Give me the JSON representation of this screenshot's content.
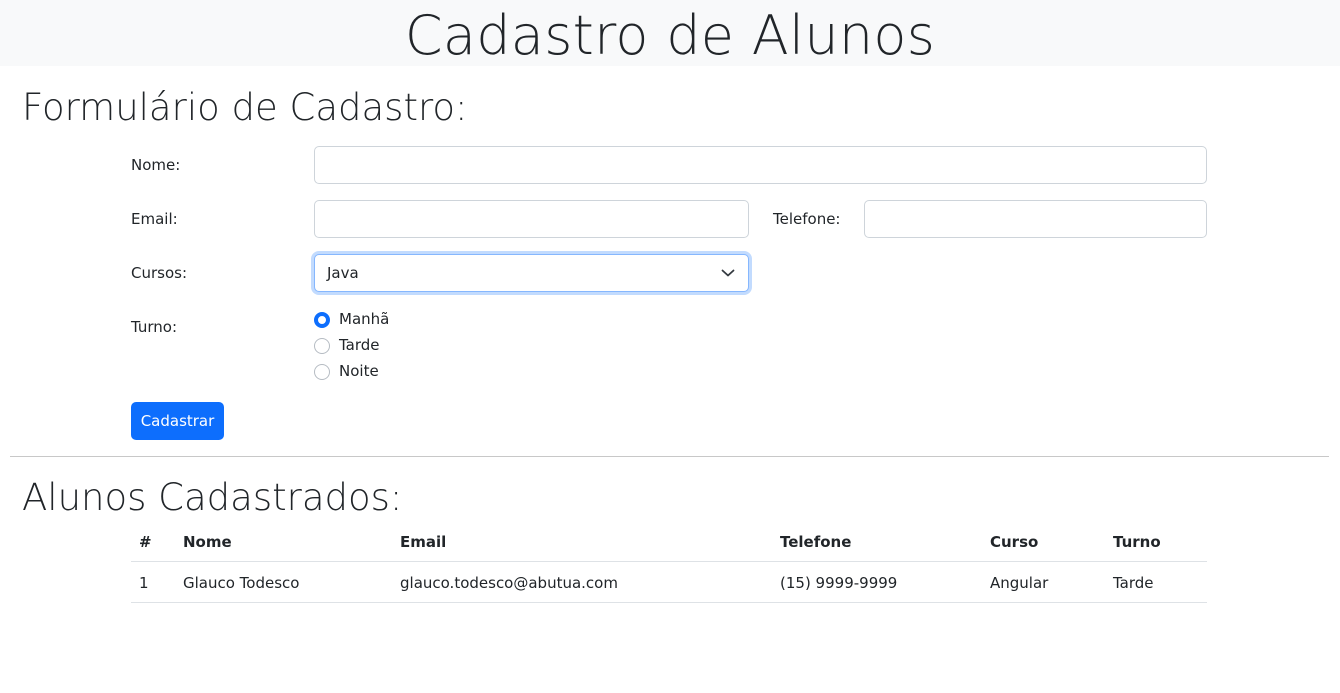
{
  "header": {
    "title": "Cadastro de Alunos"
  },
  "form": {
    "title": "Formulário de Cadastro:",
    "nome_label": "Nome:",
    "nome_value": "",
    "email_label": "Email:",
    "email_value": "",
    "telefone_label": "Telefone:",
    "telefone_value": "",
    "cursos_label": "Cursos:",
    "cursos_selected": "Java",
    "turno_label": "Turno:",
    "turno_options": [
      {
        "label": "Manhã",
        "checked": true
      },
      {
        "label": "Tarde",
        "checked": false
      },
      {
        "label": "Noite",
        "checked": false
      }
    ],
    "submit_label": "Cadastrar"
  },
  "list": {
    "title": "Alunos Cadastrados:",
    "columns": [
      "#",
      "Nome",
      "Email",
      "Telefone",
      "Curso",
      "Turno"
    ],
    "rows": [
      [
        "1",
        "Glauco Todesco",
        "glauco.todesco@abutua.com",
        "(15) 9999-9999",
        "Angular",
        "Tarde"
      ]
    ]
  },
  "colors": {
    "primary": "#0d6efd",
    "header_bg": "#f8f9fa",
    "text": "#212529",
    "input_border": "#ced4da"
  }
}
